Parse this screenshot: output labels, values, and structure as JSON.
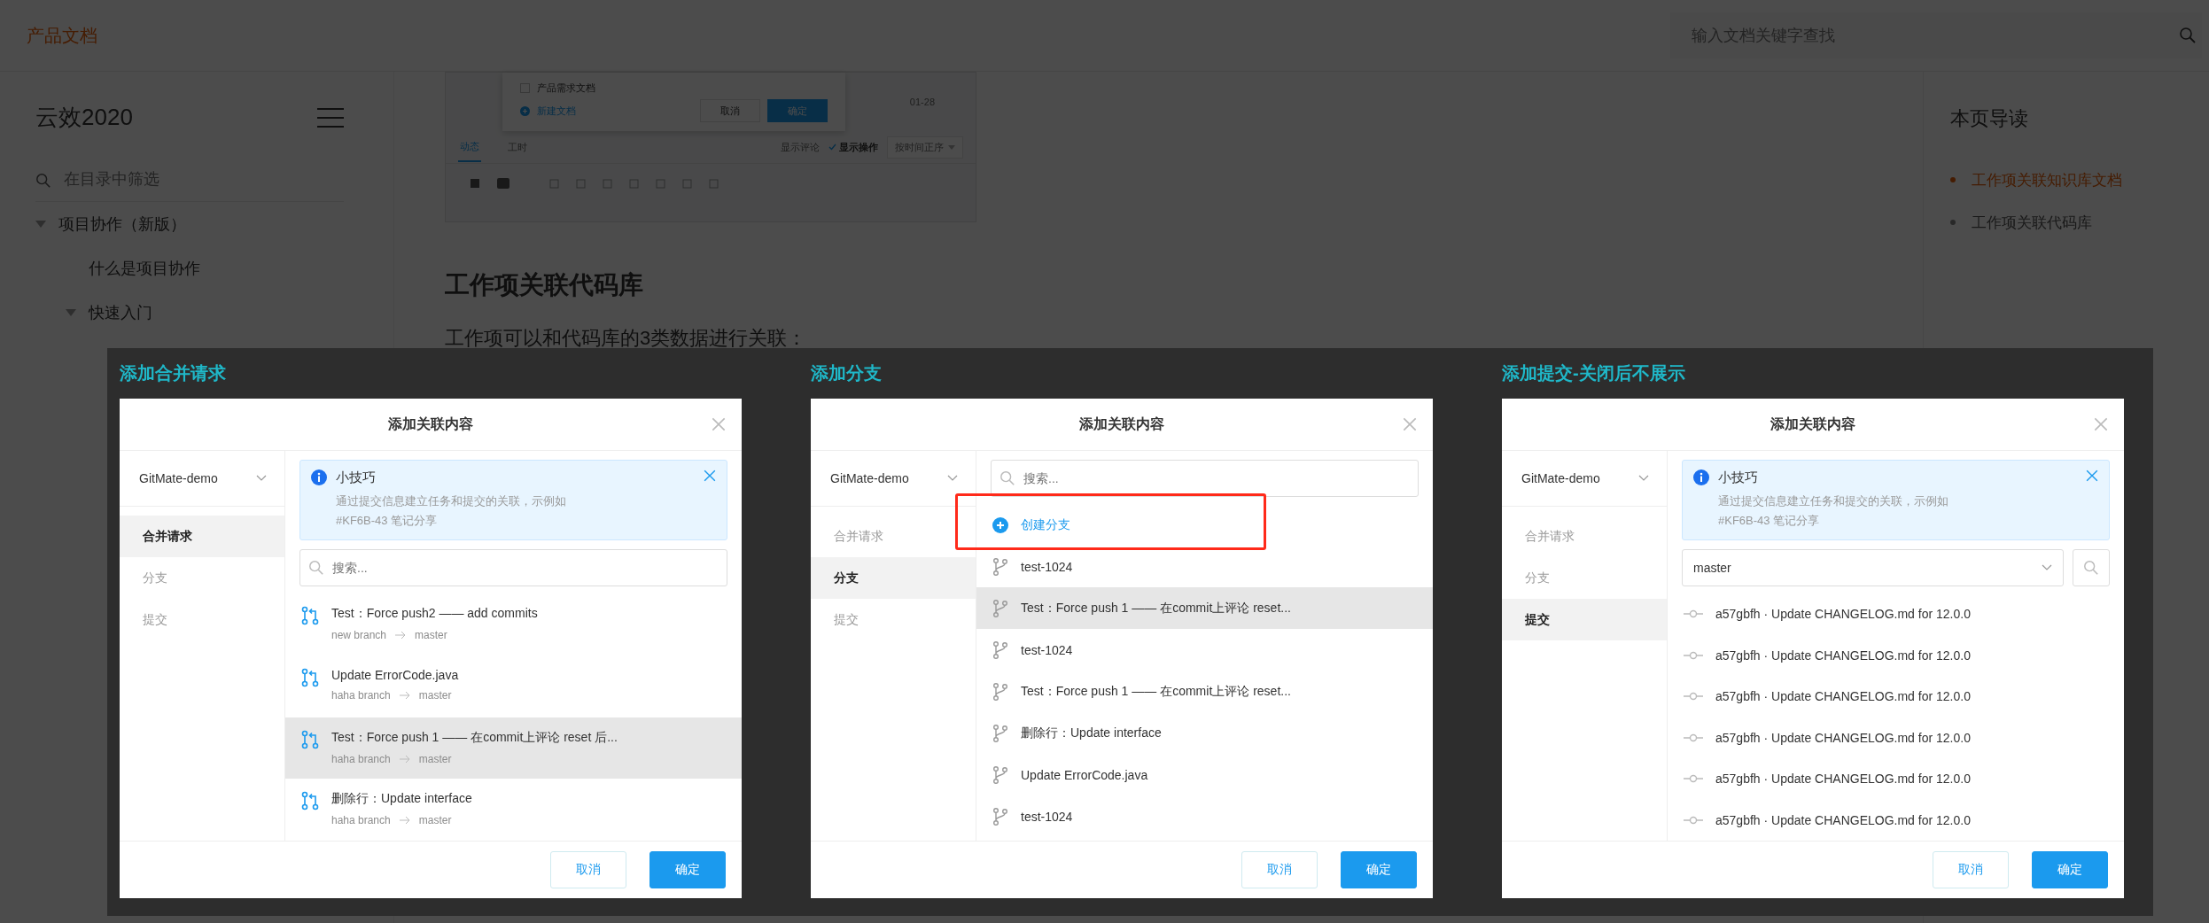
{
  "header": {
    "brand": "产品文档",
    "search": {
      "placeholder": "输入文档关键字查找"
    }
  },
  "sidebar": {
    "title": "云效2020",
    "filter": {
      "placeholder": "在目录中筛选"
    },
    "tree": [
      {
        "label": "项目协作（新版）",
        "expanded": true,
        "children": [
          {
            "label": "什么是项目协作"
          },
          {
            "label": "快速入门",
            "expanded": true
          }
        ]
      }
    ]
  },
  "content": {
    "doc_image": {
      "popup": {
        "checkbox": {
          "label": "产品需求文档",
          "checked": false
        },
        "create": "新建文档",
        "buttons": [
          {
            "label": "取消",
            "kind": "secondary"
          },
          {
            "label": "确定",
            "kind": "primary"
          }
        ]
      },
      "date": "01-28",
      "tabs": [
        {
          "label": "动态",
          "selected": true
        },
        {
          "label": "工时",
          "selected": false
        }
      ],
      "options": [
        {
          "label": "显示评论",
          "checked": false
        },
        {
          "label": "显示操作",
          "checked": true
        }
      ],
      "sort": "按时间正序"
    },
    "heading": "工作项关联代码库",
    "paragraph": "工作项可以和代码库的3类数据进行关联："
  },
  "toc": {
    "title": "本页导读",
    "items": [
      {
        "label": "工作项关联知识库文档",
        "selected": true
      },
      {
        "label": "工作项关联代码库",
        "selected": false
      }
    ]
  },
  "lightbox": {
    "panels": [
      {
        "caption": "添加合并请求",
        "dialog": {
          "title": "添加关联内容",
          "repo": "GitMate-demo",
          "nav": [
            {
              "label": "合并请求",
              "selected": true
            },
            {
              "label": "分支",
              "selected": false
            },
            {
              "label": "提交",
              "selected": false
            }
          ],
          "tip": {
            "title": "小技巧",
            "lines": [
              "通过提交信息建立任务和提交的关联，示例如",
              "#KF6B-43 笔记分享"
            ]
          },
          "search": {
            "placeholder": "搜索..."
          },
          "items": [
            {
              "kind": "merge_request",
              "title": "Test：Force push2 —— add commits",
              "source": "new branch",
              "target": "master",
              "selected": false
            },
            {
              "kind": "merge_request",
              "title": "Update ErrorCode.java",
              "source": "haha branch",
              "target": "master",
              "selected": false
            },
            {
              "kind": "merge_request",
              "title": "Test：Force push 1 —— 在commit上评论 reset 后...",
              "source": "haha branch",
              "target": "master",
              "selected": true
            },
            {
              "kind": "merge_request",
              "title": "删除行：Update interface",
              "source": "haha branch",
              "target": "master",
              "selected": false
            }
          ],
          "buttons": [
            {
              "label": "取消",
              "kind": "secondary"
            },
            {
              "label": "确定",
              "kind": "primary"
            }
          ]
        }
      },
      {
        "caption": "添加分支",
        "dialog": {
          "title": "添加关联内容",
          "repo": "GitMate-demo",
          "nav": [
            {
              "label": "合并请求",
              "selected": false
            },
            {
              "label": "分支",
              "selected": true
            },
            {
              "label": "提交",
              "selected": false
            }
          ],
          "search": {
            "placeholder": "搜索..."
          },
          "create": {
            "label": "创建分支",
            "framed": true
          },
          "items": [
            {
              "kind": "branch",
              "title": "test-1024",
              "selected": false
            },
            {
              "kind": "branch",
              "title": "Test：Force push 1 —— 在commit上评论 reset...",
              "selected": true
            },
            {
              "kind": "branch",
              "title": "test-1024",
              "selected": false
            },
            {
              "kind": "branch",
              "title": "Test：Force push 1 —— 在commit上评论 reset...",
              "selected": false
            },
            {
              "kind": "branch",
              "title": "删除行：Update interface",
              "selected": false
            },
            {
              "kind": "branch",
              "title": "Update ErrorCode.java",
              "selected": false
            },
            {
              "kind": "branch",
              "title": "test-1024",
              "selected": false
            }
          ],
          "buttons": [
            {
              "label": "取消",
              "kind": "secondary"
            },
            {
              "label": "确定",
              "kind": "primary"
            }
          ]
        }
      },
      {
        "caption": "添加提交-关闭后不展示",
        "dialog": {
          "title": "添加关联内容",
          "repo": "GitMate-demo",
          "nav": [
            {
              "label": "合并请求",
              "selected": false
            },
            {
              "label": "分支",
              "selected": false
            },
            {
              "label": "提交",
              "selected": true
            }
          ],
          "tip": {
            "title": "小技巧",
            "lines": [
              "通过提交信息建立任务和提交的关联，示例如",
              "#KF6B-43 笔记分享"
            ]
          },
          "branch_select": {
            "value": "master"
          },
          "items": [
            {
              "kind": "commit",
              "title": "a57gbfh · Update CHANGELOG.md for 12.0.0",
              "selected": false
            },
            {
              "kind": "commit",
              "title": "a57gbfh · Update CHANGELOG.md for 12.0.0",
              "selected": false
            },
            {
              "kind": "commit",
              "title": "a57gbfh · Update CHANGELOG.md for 12.0.0",
              "selected": false
            },
            {
              "kind": "commit",
              "title": "a57gbfh · Update CHANGELOG.md for 12.0.0",
              "selected": false
            },
            {
              "kind": "commit",
              "title": "a57gbfh · Update CHANGELOG.md for 12.0.0",
              "selected": false
            },
            {
              "kind": "commit",
              "title": "a57gbfh · Update CHANGELOG.md for 12.0.0",
              "selected": false
            }
          ],
          "buttons": [
            {
              "label": "取消",
              "kind": "secondary"
            },
            {
              "label": "确定",
              "kind": "primary"
            }
          ]
        }
      }
    ]
  }
}
